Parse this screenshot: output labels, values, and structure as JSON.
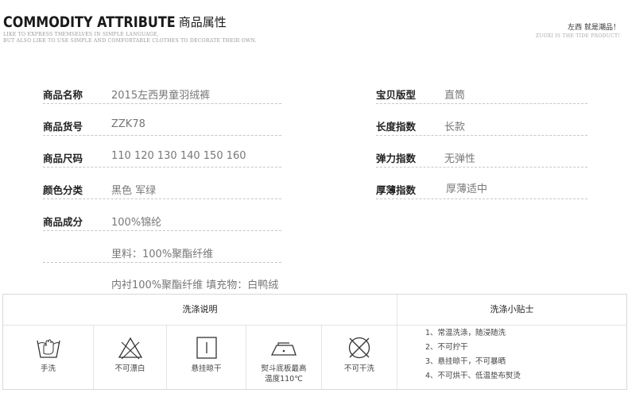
{
  "header": {
    "title_en": "COMMODITY ATTRIBUTE",
    "title_cn": "商品属性",
    "sub_line1": "LIKE TO EXPRESS THEMSELVES IN SIMPLE LANGUAGE,",
    "sub_line2": "BUT ALSO LIKE TO USE SIMPLE AND COMFORTABLE CLOTHES TO DECORATE THEIR OWN.",
    "brand": "左西  就是潮品！",
    "tagline": "ZUOXI IS THE TIDE PRODUCT!"
  },
  "attributes_left": [
    {
      "label": "商品名称",
      "value": "2015左西男童羽绒裤"
    },
    {
      "label": "商品货号",
      "value": "ZZK78"
    },
    {
      "label": "商品尺码",
      "value": "110 120 130 140 150 160"
    },
    {
      "label": "颜色分类",
      "value": "黑色 军绿"
    },
    {
      "label": "商品成分",
      "value": "100%锦纶"
    }
  ],
  "composition_extra": [
    "里料：100%聚酯纤维",
    "内衬100%聚酯纤维 填充物：白鸭绒"
  ],
  "attributes_right": [
    {
      "label": "宝贝版型",
      "value": "直筒"
    },
    {
      "label": "长度指数",
      "value": "长款"
    },
    {
      "label": "弹力指数",
      "value": "无弹性"
    },
    {
      "label": "厚薄指数",
      "value": "厚薄适中"
    }
  ],
  "care": {
    "heading_left": "洗涤说明",
    "heading_right": "洗涤小贴士",
    "icons": [
      {
        "icon": "hand-wash-icon",
        "label": "手洗"
      },
      {
        "icon": "no-bleach-icon",
        "label": "不可漂白"
      },
      {
        "icon": "hang-dry-icon",
        "label": "悬挂晾干"
      },
      {
        "icon": "iron-icon",
        "label_line1": "熨斗底板最高",
        "label_line2": "温度110℃"
      },
      {
        "icon": "no-dry-clean-icon",
        "label": "不可干洗"
      }
    ],
    "tips": [
      "1、常温洗涤，随浸随洗",
      "2、不可拧干",
      "3、悬挂晾干，不可暴晒",
      "4、不可烘干、低温垫布熨烫"
    ]
  }
}
